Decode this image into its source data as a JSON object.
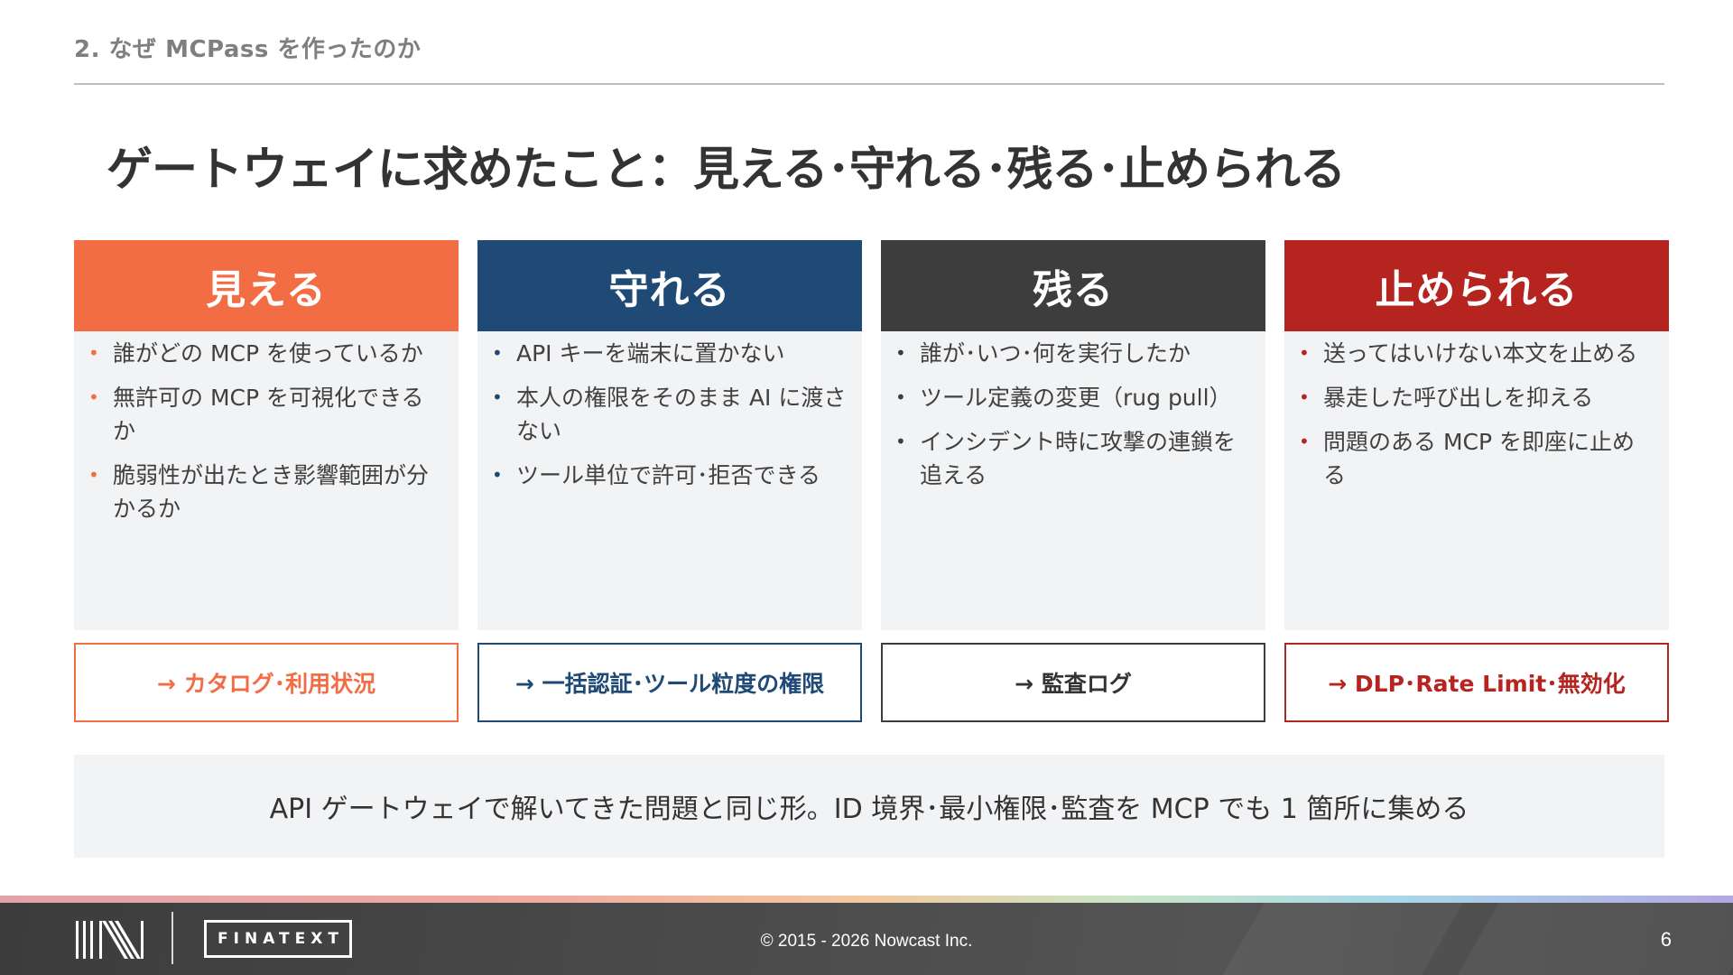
{
  "header": {
    "section_label": "2. なぜ MCPass を作ったのか",
    "title": "ゲートウェイに求めたこと：見える･守れる･残る･止められる"
  },
  "colors": {
    "orange": "#f26d43",
    "navy": "#1f4a75",
    "charcoal": "#3d3d3d",
    "red": "#b5241f",
    "panel_gray": "#f2f3f5"
  },
  "cards": [
    {
      "title": "見える",
      "bullet_icon": "bullet-dot",
      "items": [
        "誰がどの MCP を使っているか",
        "無許可の MCP を可視化できるか",
        "脆弱性が出たとき影響範囲が分かるか"
      ],
      "result": "→ カタログ･利用状況"
    },
    {
      "title": "守れる",
      "bullet_icon": "bullet-dot",
      "items": [
        "API キーを端末に置かない",
        "本人の権限をそのまま AI に渡さない",
        "ツール単位で許可･拒否できる"
      ],
      "result": "→ 一括認証･ツール粒度の権限"
    },
    {
      "title": "残る",
      "bullet_icon": "bullet-dot",
      "items": [
        "誰が･いつ･何を実行したか",
        "ツール定義の変更（rug pull）",
        "インシデント時に攻撃の連鎖を追える"
      ],
      "result": "→ 監査ログ"
    },
    {
      "title": "止められる",
      "bullet_icon": "bullet-dot",
      "items": [
        "送ってはいけない本文を止める",
        "暴走した呼び出しを抑える",
        "問題のある MCP を即座に止める"
      ],
      "result": "→ DLP･Rate Limit･無効化"
    }
  ],
  "summary": "API ゲートウェイで解いてきた問題と同じ形。ID 境界･最小権限･監査を MCP でも 1 箇所に集める",
  "footer": {
    "logo_icon": "nowcast-logo-icon",
    "brand": "FINATEXT",
    "copyright": "© 2015 - 2026 Nowcast Inc.",
    "page_number": "6"
  }
}
